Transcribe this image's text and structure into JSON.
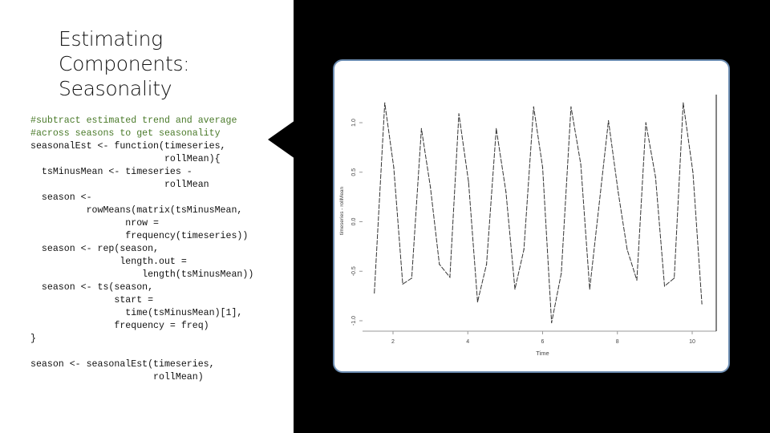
{
  "slide": {
    "title_lines": [
      "Estimating",
      "Components:",
      "Seasonality"
    ],
    "code_lines": [
      {
        "text": "#subtract estimated trend and average",
        "type": "comment"
      },
      {
        "text": "#across seasons to get seasonality",
        "type": "comment"
      },
      {
        "text": "seasonalEst <- function(timeseries,",
        "type": "code"
      },
      {
        "text": "                        rollMean){",
        "type": "code"
      },
      {
        "text": "  tsMinusMean <- timeseries -",
        "type": "code"
      },
      {
        "text": "                        rollMean",
        "type": "code"
      },
      {
        "text": "  season <-",
        "type": "code"
      },
      {
        "text": "          rowMeans(matrix(tsMinusMean,",
        "type": "code"
      },
      {
        "text": "                 nrow =",
        "type": "code"
      },
      {
        "text": "                 frequency(timeseries))",
        "type": "code"
      },
      {
        "text": "  season <- rep(season,",
        "type": "code"
      },
      {
        "text": "                length.out =",
        "type": "code"
      },
      {
        "text": "                    length(tsMinusMean))",
        "type": "code"
      },
      {
        "text": "  season <- ts(season,",
        "type": "code"
      },
      {
        "text": "               start =",
        "type": "code"
      },
      {
        "text": "                 time(tsMinusMean)[1],",
        "type": "code"
      },
      {
        "text": "               frequency = freq)",
        "type": "code"
      },
      {
        "text": "}",
        "type": "code"
      },
      {
        "text": "",
        "type": "code"
      },
      {
        "text": "season <- seasonalEst(timeseries,",
        "type": "code"
      },
      {
        "text": "                      rollMean)",
        "type": "code"
      }
    ]
  },
  "colors": {
    "comment": "#4a7a2a",
    "card_border": "#6d8db2",
    "dark_panel": "#000000"
  },
  "chart_data": {
    "type": "line",
    "title": "",
    "xlabel": "Time",
    "ylabel": "timeseries - rollMean",
    "xlim": [
      1.2,
      10.5
    ],
    "ylim": [
      -1.1,
      1.3
    ],
    "x_ticks": [
      2,
      4,
      6,
      8,
      10
    ],
    "x_tick_labels": [
      "2",
      "4",
      "6",
      "8",
      "10"
    ],
    "y_ticks": [
      -1.0,
      -0.5,
      0.0,
      0.5,
      1.0
    ],
    "y_tick_labels": [
      "-1.0",
      "-0.5",
      "0.0",
      "0.5",
      "1.0"
    ],
    "grid": false,
    "series": [
      {
        "name": "timeseries - rollMean",
        "x": [
          1.5,
          1.78,
          2.02,
          2.26,
          2.5,
          2.76,
          3.0,
          3.24,
          3.52,
          3.76,
          4.02,
          4.26,
          4.5,
          4.76,
          5.02,
          5.26,
          5.5,
          5.76,
          6.0,
          6.24,
          6.5,
          6.76,
          7.02,
          7.26,
          7.76,
          8.02,
          8.26,
          8.52,
          8.76,
          9.02,
          9.26,
          9.52,
          9.76,
          10.02,
          10.26
        ],
        "y": [
          -0.72,
          1.2,
          0.55,
          -0.63,
          -0.57,
          0.94,
          0.35,
          -0.43,
          -0.56,
          1.09,
          0.4,
          -0.81,
          -0.43,
          0.94,
          0.3,
          -0.68,
          -0.28,
          1.16,
          0.55,
          -1.02,
          -0.52,
          1.16,
          0.58,
          -0.68,
          1.02,
          0.3,
          -0.28,
          -0.59,
          1.0,
          0.45,
          -0.65,
          -0.57,
          1.2,
          0.5,
          -0.83
        ]
      }
    ]
  }
}
